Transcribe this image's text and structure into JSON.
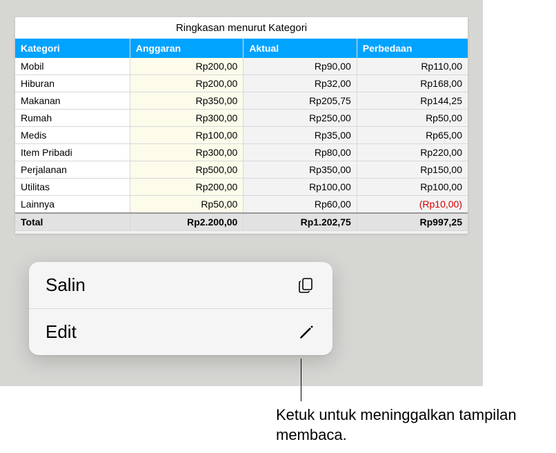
{
  "table": {
    "title": "Ringkasan menurut Kategori",
    "headers": {
      "category": "Kategori",
      "budget": "Anggaran",
      "actual": "Aktual",
      "diff": "Perbedaan"
    },
    "rows": [
      {
        "cat": "Mobil",
        "budget": "Rp200,00",
        "actual": "Rp90,00",
        "diff": "Rp110,00",
        "neg": false
      },
      {
        "cat": "Hiburan",
        "budget": "Rp200,00",
        "actual": "Rp32,00",
        "diff": "Rp168,00",
        "neg": false
      },
      {
        "cat": "Makanan",
        "budget": "Rp350,00",
        "actual": "Rp205,75",
        "diff": "Rp144,25",
        "neg": false
      },
      {
        "cat": "Rumah",
        "budget": "Rp300,00",
        "actual": "Rp250,00",
        "diff": "Rp50,00",
        "neg": false
      },
      {
        "cat": "Medis",
        "budget": "Rp100,00",
        "actual": "Rp35,00",
        "diff": "Rp65,00",
        "neg": false
      },
      {
        "cat": "Item Pribadi",
        "budget": "Rp300,00",
        "actual": "Rp80,00",
        "diff": "Rp220,00",
        "neg": false
      },
      {
        "cat": "Perjalanan",
        "budget": "Rp500,00",
        "actual": "Rp350,00",
        "diff": "Rp150,00",
        "neg": false
      },
      {
        "cat": "Utilitas",
        "budget": "Rp200,00",
        "actual": "Rp100,00",
        "diff": "Rp100,00",
        "neg": false
      },
      {
        "cat": "Lainnya",
        "budget": "Rp50,00",
        "actual": "Rp60,00",
        "diff": "(Rp10,00)",
        "neg": true
      }
    ],
    "total": {
      "cat": "Total",
      "budget": "Rp2.200,00",
      "actual": "Rp1.202,75",
      "diff": "Rp997,25"
    }
  },
  "menu": {
    "copy": "Salin",
    "edit": "Edit"
  },
  "callout": "Ketuk untuk meninggalkan tampilan membaca."
}
